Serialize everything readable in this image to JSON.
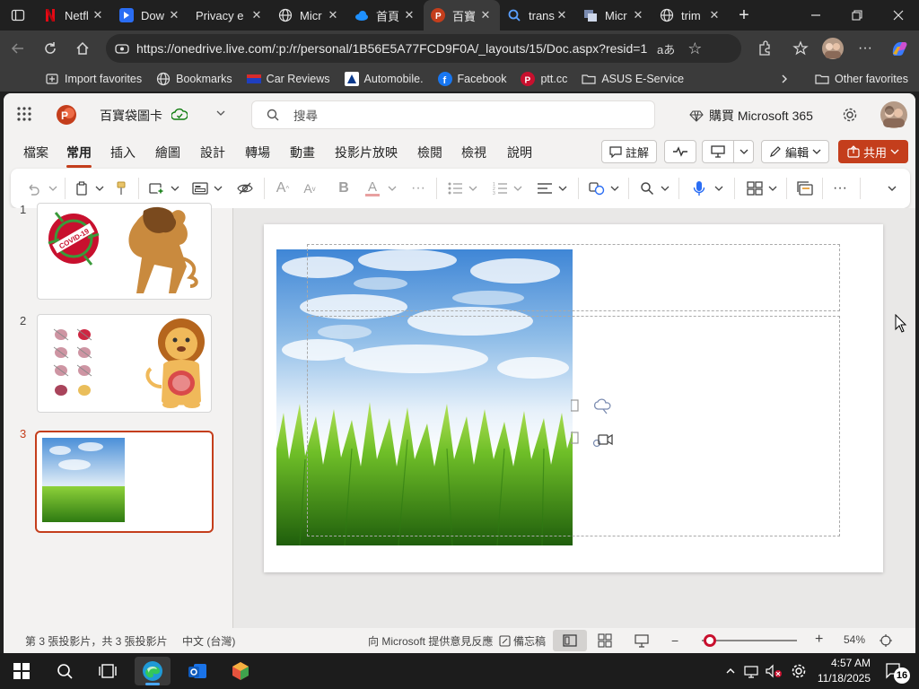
{
  "browser": {
    "tabs": [
      {
        "label": "Netfl",
        "icon": "netflix-icon",
        "color": "#e50914"
      },
      {
        "label": "Dow",
        "icon": "download-icon",
        "color": "#2a6df4"
      },
      {
        "label": "Privacy e",
        "icon": "none",
        "color": ""
      },
      {
        "label": "Micr",
        "icon": "globe-icon",
        "color": ""
      },
      {
        "label": "首頁",
        "icon": "onedrive-icon",
        "color": "#1e90ff"
      },
      {
        "label": "百寶",
        "icon": "powerpoint-icon",
        "color": "#c43e1c",
        "active": true
      },
      {
        "label": "trans",
        "icon": "search-icon",
        "color": "#2a6df4"
      },
      {
        "label": "Micr",
        "icon": "microsoft-icon",
        "color": ""
      },
      {
        "label": "trim",
        "icon": "globe-icon",
        "color": ""
      }
    ],
    "url": "https://onedrive.live.com/:p:/r/personal/1B56E5A77FCD9F0A/_layouts/15/Doc.aspx?resid=1...",
    "favorites": [
      "Import favorites",
      "Bookmarks",
      "Car Reviews",
      "Automobile.",
      "Facebook",
      "ptt.cc",
      "ASUS E-Service"
    ],
    "other_favorites": "Other favorites"
  },
  "app": {
    "doc_title": "百寶袋圖卡",
    "search_placeholder": "搜尋",
    "buy_label": "購買 Microsoft 365",
    "menu": [
      "檔案",
      "常用",
      "插入",
      "繪圖",
      "設計",
      "轉場",
      "動畫",
      "投影片放映",
      "檢閱",
      "檢視",
      "說明"
    ],
    "active_menu": "常用",
    "comment_label": "註解",
    "edit_label": "編輯",
    "share_label": "共用",
    "accent": "#c43e1c"
  },
  "slides": [
    {
      "number": "1",
      "badge_text": "COVID-19"
    },
    {
      "number": "2"
    },
    {
      "number": "3",
      "selected": true
    }
  ],
  "status": {
    "slide_count": "第 3 張投影片，共 3 張投影片",
    "language": "中文 (台灣)",
    "feedback": "向 Microsoft 提供意見反應",
    "notes": "備忘稿",
    "zoom": "54%",
    "zoom_level": 0.3
  },
  "taskbar": {
    "time": "4:57 AM",
    "date": "11/18/2025",
    "notifications": "16"
  }
}
